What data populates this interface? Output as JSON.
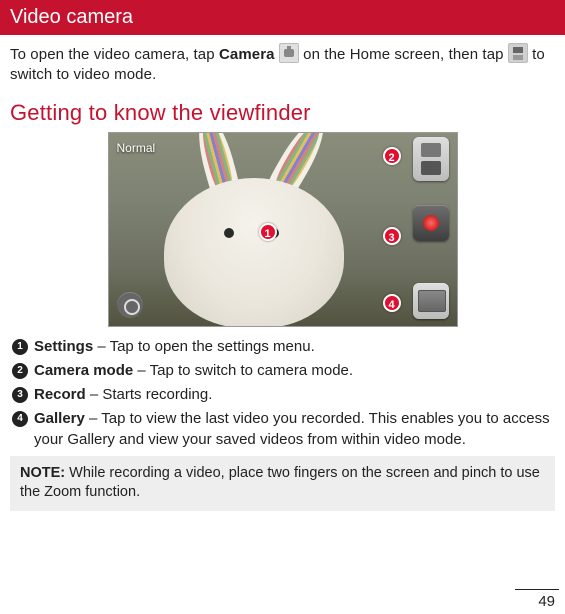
{
  "header": {
    "title": "Video camera"
  },
  "intro": {
    "part1": "To open the video camera, tap ",
    "bold1": "Camera",
    "part2": " ",
    "part3": " on the Home screen, then tap ",
    "part4": " to switch to video mode."
  },
  "subheading": "Getting to know the viewfinder",
  "viewfinder": {
    "mode_label": "Normal",
    "markers": [
      "1",
      "2",
      "3",
      "4"
    ]
  },
  "callouts": [
    {
      "num": "1",
      "bold": "Settings",
      "text": " – Tap to open the settings menu."
    },
    {
      "num": "2",
      "bold": "Camera mode",
      "text": " – Tap to switch to camera mode."
    },
    {
      "num": "3",
      "bold": "Record",
      "text": " – Starts recording."
    },
    {
      "num": "4",
      "bold": "Gallery",
      "text": " – Tap to view the last video you recorded. This enables you to access your Gallery and view your saved videos from within video mode."
    }
  ],
  "note": {
    "label": "NOTE:",
    "text": " While recording a video, place two fingers on the screen and pinch to use the Zoom function."
  },
  "page_number": "49"
}
